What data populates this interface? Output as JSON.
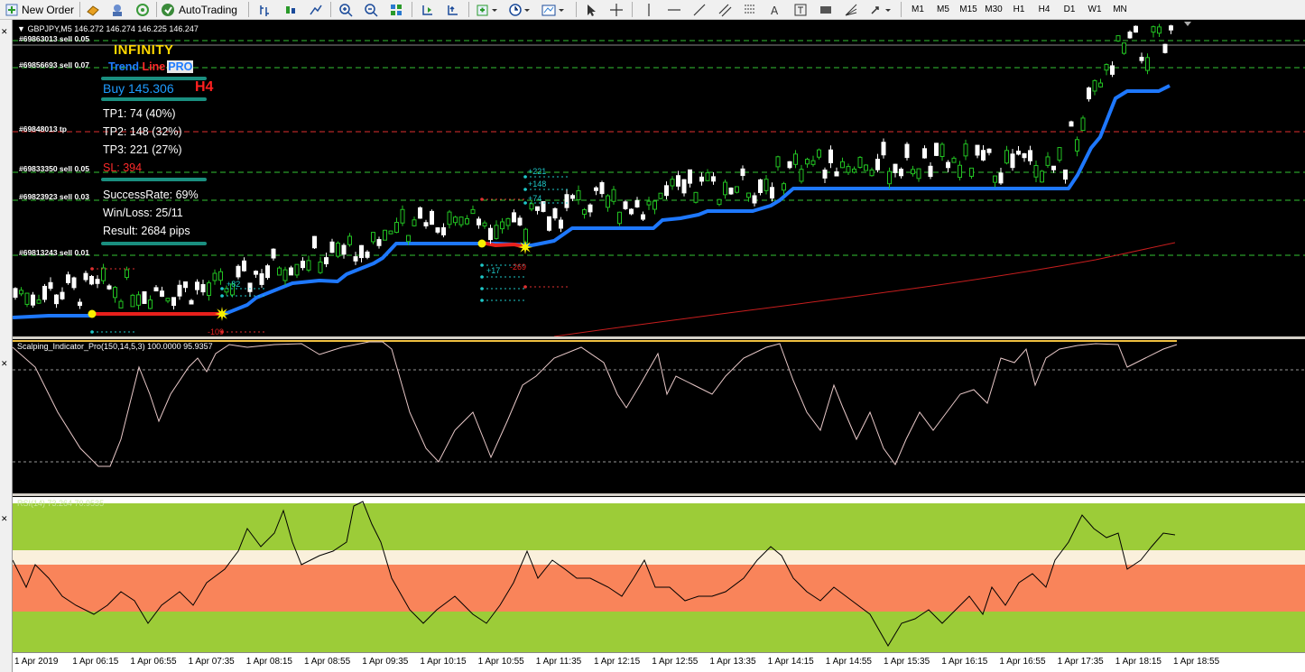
{
  "toolbar": {
    "new_order": "New Order",
    "auto_trading": "AutoTrading",
    "timeframes": [
      "M1",
      "M5",
      "M15",
      "M30",
      "H1",
      "H4",
      "D1",
      "W1",
      "MN"
    ]
  },
  "chart": {
    "symbol_header": "GBPJPY,M5  146.272 146.274 146.225 146.247"
  },
  "order_lines": [
    {
      "label": "#69863013 sell 0.05",
      "color": "#34c334"
    },
    {
      "label": "#69856693 sell 0.07",
      "color": "#34c334"
    },
    {
      "label": "#69848013 tp",
      "color": "#e03030"
    },
    {
      "label": "#69833350 sell 0.05",
      "color": "#34c334"
    },
    {
      "label": "#69823923 sell 0.03",
      "color": "#34c334"
    },
    {
      "label": "#69813243 sell 0.01",
      "color": "#34c334"
    }
  ],
  "panel": {
    "brand_line1": "INFINITY",
    "brand_trend": "Trend",
    "brand_line": "Line",
    "brand_pro": "PRO",
    "signal": "Buy 145.306",
    "timeframe": "H4",
    "tp1": "TP1: 74 (40%)",
    "tp2": "TP2: 148 (32%)",
    "tp3": "TP3: 221 (27%)",
    "sl": "SL: 394",
    "success_rate": "SuccessRate: 69%",
    "win_loss": "Win/Loss: 25/11",
    "result": "Result: 2684 pips"
  },
  "annotations": {
    "a1": "+82",
    "a2": "-109",
    "a3": "+221",
    "a4": "+148",
    "a5": "+74",
    "a6": "-269",
    "a7": "+17"
  },
  "oscillator": {
    "label": "Scalping_Indicator_Pro(150,14,5,3) 100.0000 95.9357",
    "line_color": "#e8c8c8"
  },
  "rsi": {
    "label": "RSI(14) 73.264  70.9535",
    "zone_colors": {
      "green": "#9ccc38",
      "cream": "#faf0dc",
      "salmon": "#f9845a"
    }
  },
  "time_axis": [
    "1 Apr 2019",
    "1 Apr 06:15",
    "1 Apr 06:55",
    "1 Apr 07:35",
    "1 Apr 08:15",
    "1 Apr 08:55",
    "1 Apr 09:35",
    "1 Apr 10:15",
    "1 Apr 10:55",
    "1 Apr 11:35",
    "1 Apr 12:15",
    "1 Apr 12:55",
    "1 Apr 13:35",
    "1 Apr 14:15",
    "1 Apr 14:55",
    "1 Apr 15:35",
    "1 Apr 16:15",
    "1 Apr 16:55",
    "1 Apr 17:35",
    "1 Apr 18:15",
    "1 Apr 18:55"
  ],
  "colors": {
    "trend_up": "#1e78ff",
    "trend_down": "#e8201c",
    "candle_up": "#22c222",
    "candle_down": "#ffffff",
    "signal_dot": "#f8f000",
    "ma_line": "#c81e1e"
  }
}
